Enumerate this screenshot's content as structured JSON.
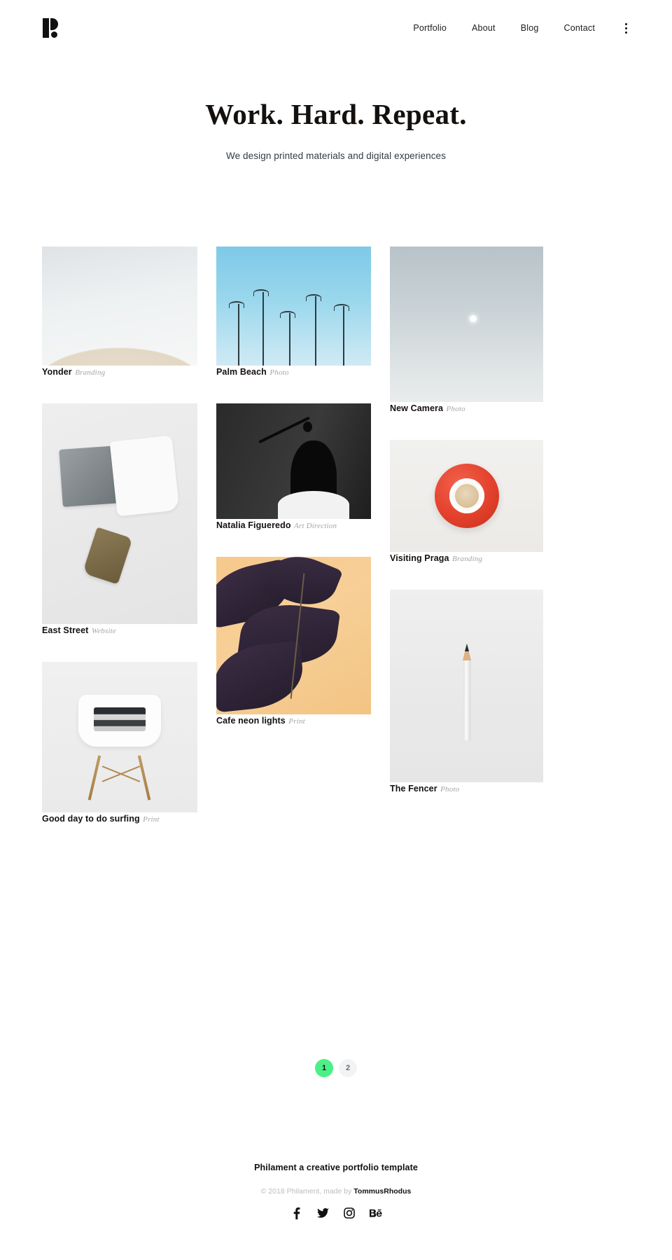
{
  "header": {
    "logo_alt": "Philament logo",
    "nav": [
      {
        "label": "Portfolio"
      },
      {
        "label": "About"
      },
      {
        "label": "Blog"
      },
      {
        "label": "Contact"
      }
    ],
    "menu_icon": "kebab-menu-icon"
  },
  "hero": {
    "title": "Work. Hard. Repeat.",
    "subtitle": "We design printed materials and digital experiences"
  },
  "portfolio": {
    "columns": [
      {
        "items": [
          {
            "title": "Yonder",
            "category": "Branding"
          },
          {
            "title": "East Street",
            "category": "Website"
          },
          {
            "title": "Good day to do surfing",
            "category": "Print"
          }
        ]
      },
      {
        "items": [
          {
            "title": "Palm Beach",
            "category": "Photo"
          },
          {
            "title": "Natalia Figueredo",
            "category": "Art Direction"
          },
          {
            "title": "Cafe neon lights",
            "category": "Print"
          }
        ]
      },
      {
        "items": [
          {
            "title": "New Camera",
            "category": "Photo"
          },
          {
            "title": "Visiting Praga",
            "category": "Branding"
          },
          {
            "title": "The Fencer",
            "category": "Photo"
          }
        ]
      }
    ]
  },
  "pagination": {
    "pages": [
      {
        "label": "1",
        "active": true
      },
      {
        "label": "2",
        "active": false
      }
    ],
    "active_color": "#4cf088"
  },
  "footer": {
    "title": "Philament a creative portfolio template",
    "copyright_prefix": "© 2018 Philament, made by ",
    "author": "TommusRhodus",
    "social": [
      {
        "name": "facebook-icon",
        "label": "f"
      },
      {
        "name": "twitter-icon",
        "label": "t"
      },
      {
        "name": "instagram-icon",
        "label": "ig"
      },
      {
        "name": "behance-icon",
        "label": "Bē"
      }
    ]
  }
}
